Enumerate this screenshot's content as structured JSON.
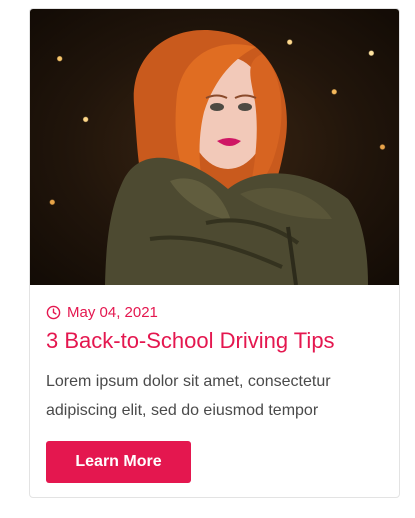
{
  "post": {
    "date": "May 04, 2021",
    "title": "3 Back-to-School Driving Tips",
    "excerpt": "Lorem ipsum dolor sit amet, consectetur adipiscing elit, sed do eiusmod tempor",
    "button_label": "Learn More",
    "image_alt": "Portrait of a woman with red hair wearing an olive puffer jacket against a golden sparkle background"
  },
  "colors": {
    "accent": "#e4174f",
    "text": "#4a4a4a",
    "card_border": "#e3e3e3"
  },
  "icons": {
    "date": "clock-icon"
  }
}
